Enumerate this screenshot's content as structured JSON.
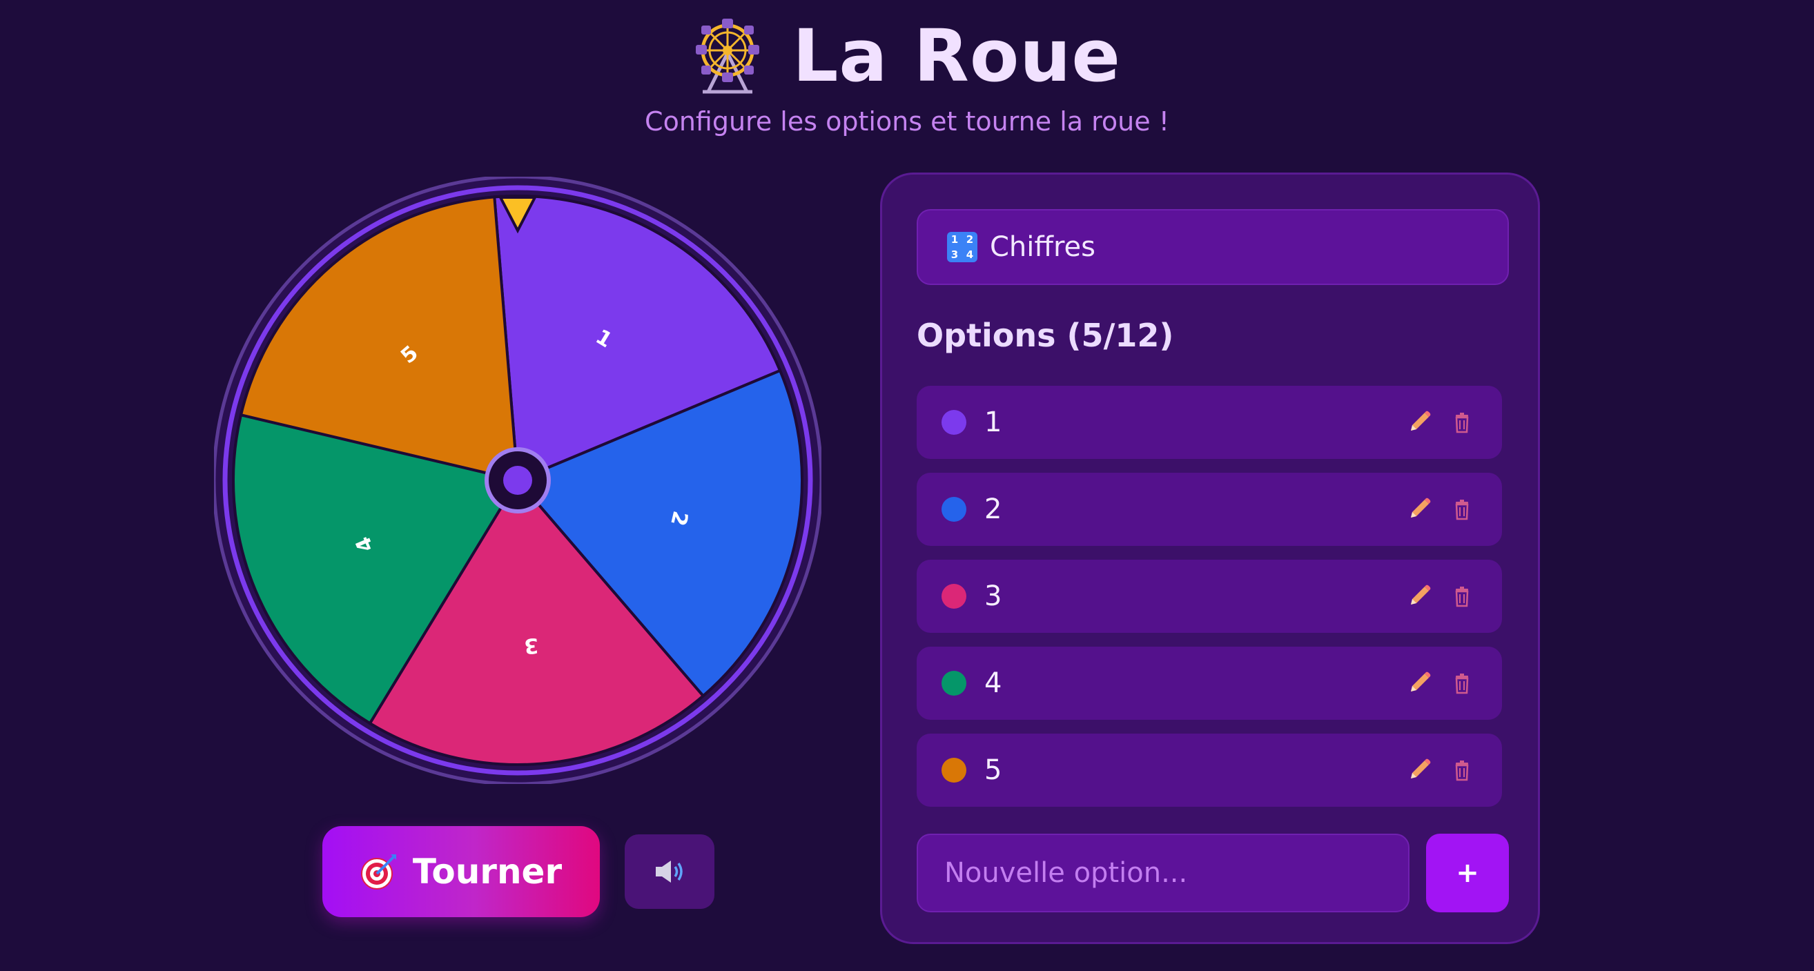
{
  "header": {
    "icon": "ferris-wheel-icon",
    "title": "La Roue",
    "subtitle": "Configure les options et tourne la roue !"
  },
  "wheel": {
    "pointer_color": "#fbbf24",
    "ring_color": "#7c3aed",
    "segments": [
      {
        "label": "1",
        "color": "#7c3aed"
      },
      {
        "label": "2",
        "color": "#2563eb"
      },
      {
        "label": "3",
        "color": "#db2777"
      },
      {
        "label": "4",
        "color": "#059669"
      },
      {
        "label": "5",
        "color": "#d97706"
      }
    ]
  },
  "controls": {
    "spin_icon": "target-icon",
    "spin_label": "Tourner",
    "sound_icon": "speaker-icon"
  },
  "panel": {
    "preset_icon": "numbers-icon",
    "preset_label": "Chiffres",
    "options_title": "Options (5/12)",
    "options": [
      {
        "label": "1",
        "color": "#7c3aed"
      },
      {
        "label": "2",
        "color": "#2563eb"
      },
      {
        "label": "3",
        "color": "#db2777"
      },
      {
        "label": "4",
        "color": "#059669"
      },
      {
        "label": "5",
        "color": "#d97706"
      }
    ],
    "new_option_placeholder": "Nouvelle option...",
    "add_label": "+"
  }
}
